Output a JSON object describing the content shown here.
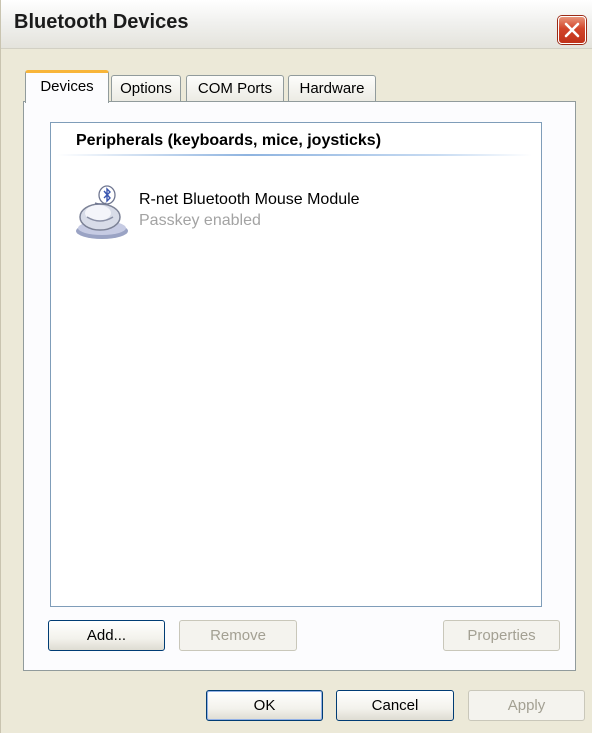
{
  "window": {
    "title": "Bluetooth Devices"
  },
  "tabs": [
    {
      "label": "Devices",
      "active": true
    },
    {
      "label": "Options",
      "active": false
    },
    {
      "label": "COM Ports",
      "active": false
    },
    {
      "label": "Hardware",
      "active": false
    }
  ],
  "device_list": {
    "group_header": "Peripherals (keyboards, mice, joysticks)",
    "items": [
      {
        "name": "R-net Bluetooth Mouse Module",
        "status": "Passkey enabled",
        "icon": "bluetooth-mouse-icon"
      }
    ]
  },
  "panel_buttons": {
    "add": "Add...",
    "remove": "Remove",
    "properties": "Properties"
  },
  "dialog_buttons": {
    "ok": "OK",
    "cancel": "Cancel",
    "apply": "Apply"
  },
  "colors": {
    "dialog_bg": "#ece9d8",
    "active_tab_accent": "#f8b53a",
    "close_button": "#d2452a",
    "disabled_text": "#a3a093"
  }
}
